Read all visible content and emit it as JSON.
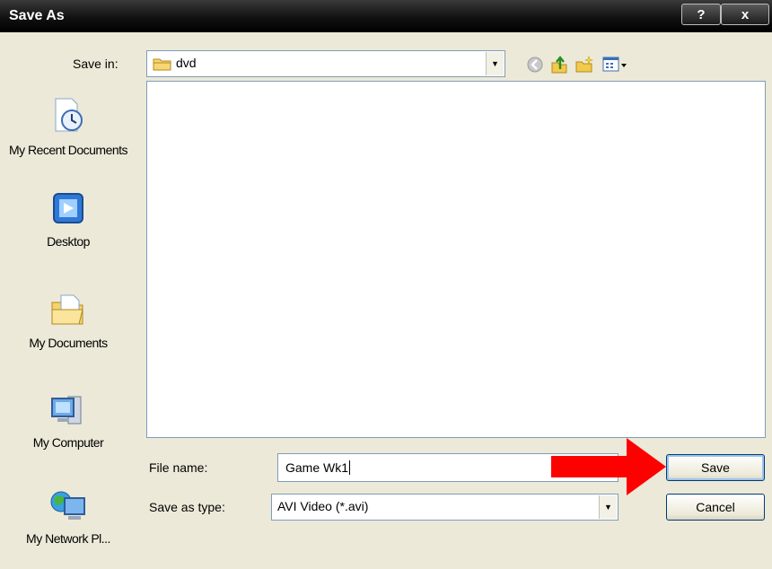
{
  "window": {
    "title": "Save As",
    "help_label": "?",
    "close_label": "x"
  },
  "toolbar": {
    "save_in_label": "Save in:",
    "save_in_value": "dvd",
    "icons": [
      "back-icon",
      "up-folder-icon",
      "new-folder-icon",
      "views-menu-icon"
    ]
  },
  "places": [
    {
      "label": "My Recent Documents",
      "icon": "recent-documents-icon"
    },
    {
      "label": "Desktop",
      "icon": "desktop-icon"
    },
    {
      "label": "My Documents",
      "icon": "my-documents-icon"
    },
    {
      "label": "My Computer",
      "icon": "my-computer-icon"
    },
    {
      "label": "My Network Pl...",
      "icon": "my-network-icon"
    }
  ],
  "form": {
    "file_name_label": "File name:",
    "file_name_value": "Game Wk1",
    "save_type_label": "Save as type:",
    "save_type_value": "AVI Video (*.avi)",
    "save_button": "Save",
    "cancel_button": "Cancel"
  },
  "annotation": {
    "arrow_color": "#ff0000",
    "points_to": "save-button"
  }
}
